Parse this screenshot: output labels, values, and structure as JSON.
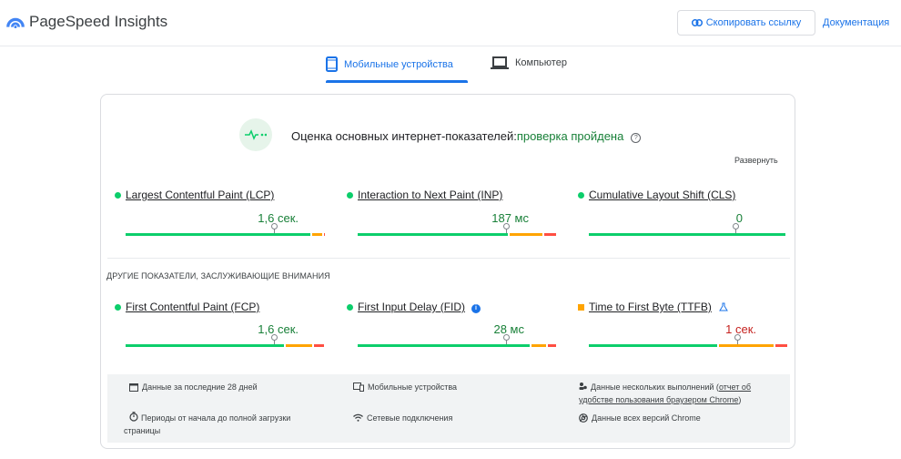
{
  "header": {
    "brand": "PageSpeed Insights",
    "copy_label": "Скопировать ссылку",
    "docs_label": "Документация"
  },
  "tabs": [
    {
      "label": "Мобильные устройства",
      "active": true
    },
    {
      "label": "Компьютер",
      "active": false
    }
  ],
  "assessment": {
    "prefix": "Оценка основных интернет-показателей:",
    "status": "проверка пройдена",
    "expand_label": "Развернуть"
  },
  "core_metrics": [
    {
      "name": "Largest Contentful Paint (LCP)",
      "value": "1,6 сек.",
      "status": "good",
      "distribution": {
        "good": 0.93,
        "needs_improvement": 0.06,
        "poor": 0.01
      },
      "marker_fraction": 0.74
    },
    {
      "name": "Interaction to Next Paint (INP)",
      "value": "187 мс",
      "status": "good",
      "distribution": {
        "good": 0.76,
        "needs_improvement": 0.17,
        "poor": 0.07
      },
      "marker_fraction": 0.74
    },
    {
      "name": "Cumulative Layout Shift (CLS)",
      "value": "0",
      "status": "good",
      "distribution": {
        "good": 1.0,
        "needs_improvement": 0.0,
        "poor": 0.0
      },
      "marker_fraction": 0.74
    }
  ],
  "other_section_title": "ДРУГИЕ ПОКАЗАТЕЛИ, ЗАСЛУЖИВАЮЩИЕ ВНИМАНИЯ",
  "other_metrics": [
    {
      "name": "First Contentful Paint (FCP)",
      "value": "1,6 сек.",
      "status": "good",
      "distribution": {
        "good": 0.8,
        "needs_improvement": 0.14,
        "poor": 0.06
      },
      "marker_fraction": 0.74
    },
    {
      "name": "First Input Delay (FID)",
      "value": "28 мс",
      "status": "good",
      "distribution": {
        "good": 0.87,
        "needs_improvement": 0.08,
        "poor": 0.05
      },
      "marker_fraction": 0.74
    },
    {
      "name": "Time to First Byte (TTFB)",
      "value": "1 сек.",
      "status": "average",
      "distribution": {
        "good": 0.65,
        "needs_improvement": 0.28,
        "poor": 0.07
      },
      "marker_fraction": 0.74
    }
  ],
  "footer": {
    "period": "Данные за последние 28 дней",
    "device": "Мобильные устройства",
    "sessions_prefix": "Данные нескольких выполнений (",
    "sessions_link": "отчет об удобстве пользования браузером Chrome",
    "sessions_suffix": ")",
    "durations": "Периоды от начала до полной загрузки страницы",
    "network": "Сетевые подключения",
    "chrome": "Данные всех версий Chrome"
  },
  "colors": {
    "good": "#0cce6b",
    "average": "#ffa400",
    "poor": "#ff4e42",
    "accent": "#1a73e8",
    "pass": "#188038"
  }
}
